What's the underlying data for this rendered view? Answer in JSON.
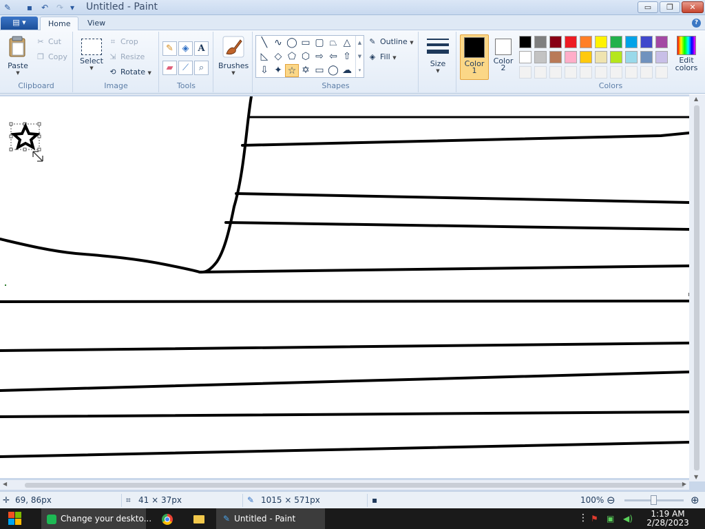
{
  "titlebar": {
    "title": "Untitled - Paint",
    "minimize": "▭",
    "maximize": "❐",
    "close": "✕"
  },
  "tabs": {
    "app_menu": "▤ ▾",
    "home": "Home",
    "view": "View",
    "help": "?"
  },
  "ribbon": {
    "clipboard": {
      "label": "Clipboard",
      "paste": "Paste",
      "cut": "Cut",
      "copy": "Copy"
    },
    "image": {
      "label": "Image",
      "select": "Select",
      "crop": "Crop",
      "resize": "Resize",
      "rotate": "Rotate"
    },
    "tools": {
      "label": "Tools"
    },
    "brushes": {
      "label": "Brushes"
    },
    "shapes": {
      "label": "Shapes",
      "outline": "Outline",
      "fill": "Fill"
    },
    "size": {
      "label": "Size"
    },
    "color1": {
      "line1": "Color",
      "line2": "1",
      "value": "#000000"
    },
    "color2": {
      "line1": "Color",
      "line2": "2",
      "value": "#ffffff"
    },
    "colors": {
      "label": "Colors",
      "edit": "Edit colors",
      "palette_row1": [
        "#000000",
        "#7f7f7f",
        "#880015",
        "#ed1c24",
        "#ff7f27",
        "#fff200",
        "#22b14c",
        "#00a2e8",
        "#3f48cc",
        "#a349a4"
      ],
      "palette_row2": [
        "#ffffff",
        "#c3c3c3",
        "#b97a57",
        "#ffaec9",
        "#ffc90e",
        "#efe4b0",
        "#b5e61d",
        "#99d9ea",
        "#7092be",
        "#c8bfe7"
      ],
      "palette_row3": [
        "#f2f2f2",
        "#f2f2f2",
        "#f2f2f2",
        "#f2f2f2",
        "#f2f2f2",
        "#f2f2f2",
        "#f2f2f2",
        "#f2f2f2",
        "#f2f2f2",
        "#f2f2f2"
      ]
    }
  },
  "status": {
    "cursor_pos": "69, 86px",
    "selection_size": "41 × 37px",
    "canvas_size": "1015 × 571px",
    "zoom": "100%"
  },
  "taskbar": {
    "app1": "Change your deskto...",
    "app2": "Untitled - Paint",
    "time": "1:19 AM",
    "date": "2/28/2023"
  }
}
